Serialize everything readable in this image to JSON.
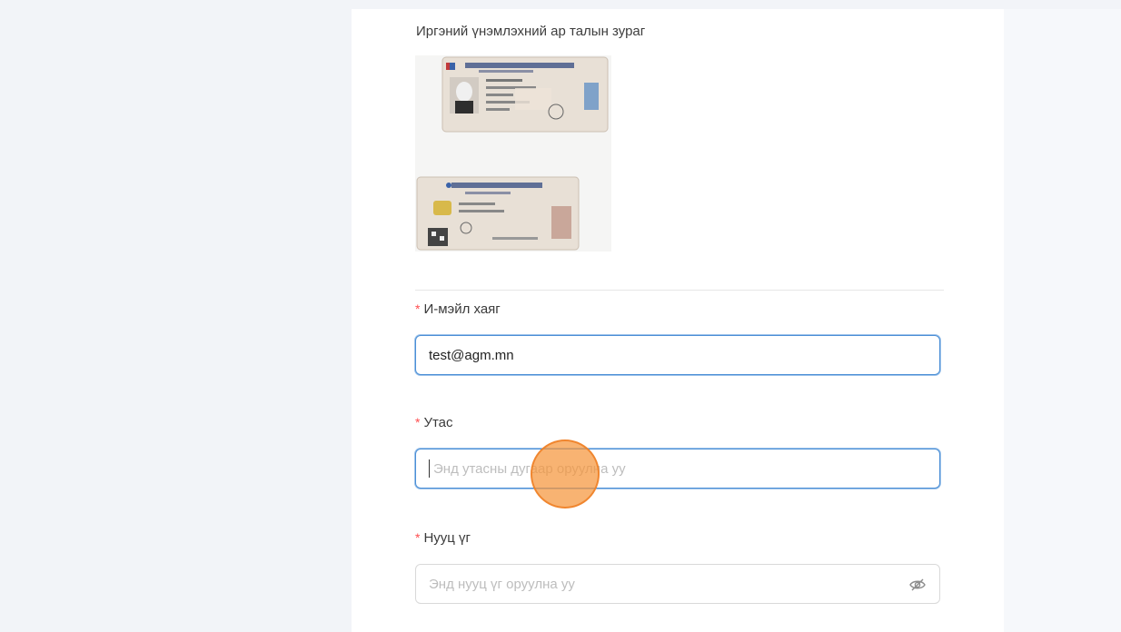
{
  "id_back": {
    "caption": "Иргэний үнэмлэхний ар талын зураг"
  },
  "email": {
    "label": "И-мэйл хаяг",
    "required_mark": "*",
    "value": "test@agm.mn"
  },
  "phone": {
    "label": "Утас",
    "required_mark": "*",
    "placeholder": "Энд утасны дугаар оруулна уу"
  },
  "password": {
    "label": "Нууц үг",
    "required_mark": "*",
    "placeholder": "Энд нууц үг оруулна уу",
    "toggle_icon": "eye-off-icon"
  },
  "colors": {
    "required": "#ff4d4f",
    "focus_border": "#4b8fd6",
    "click_indicator": "#f5963c"
  }
}
